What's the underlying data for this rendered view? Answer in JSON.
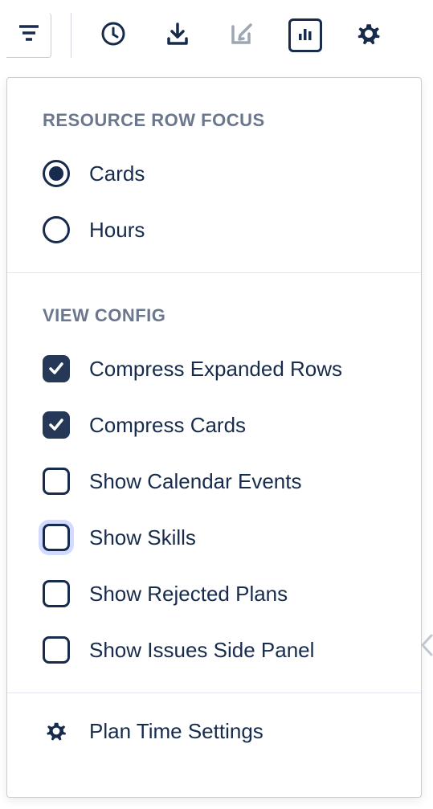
{
  "sections": {
    "focus": {
      "header": "RESOURCE ROW FOCUS",
      "options": {
        "cards": "Cards",
        "hours": "Hours"
      },
      "selected": "cards"
    },
    "view": {
      "header": "VIEW CONFIG",
      "items": [
        {
          "key": "compress_rows",
          "label": "Compress Expanded Rows",
          "checked": true
        },
        {
          "key": "compress_cards",
          "label": "Compress Cards",
          "checked": true
        },
        {
          "key": "show_calendar",
          "label": "Show Calendar Events",
          "checked": false
        },
        {
          "key": "show_skills",
          "label": "Show Skills",
          "checked": false,
          "focused": true
        },
        {
          "key": "show_rejected",
          "label": "Show Rejected Plans",
          "checked": false
        },
        {
          "key": "show_issues_panel",
          "label": "Show Issues Side Panel",
          "checked": false
        }
      ]
    },
    "action": {
      "plan_time": "Plan Time Settings"
    }
  }
}
